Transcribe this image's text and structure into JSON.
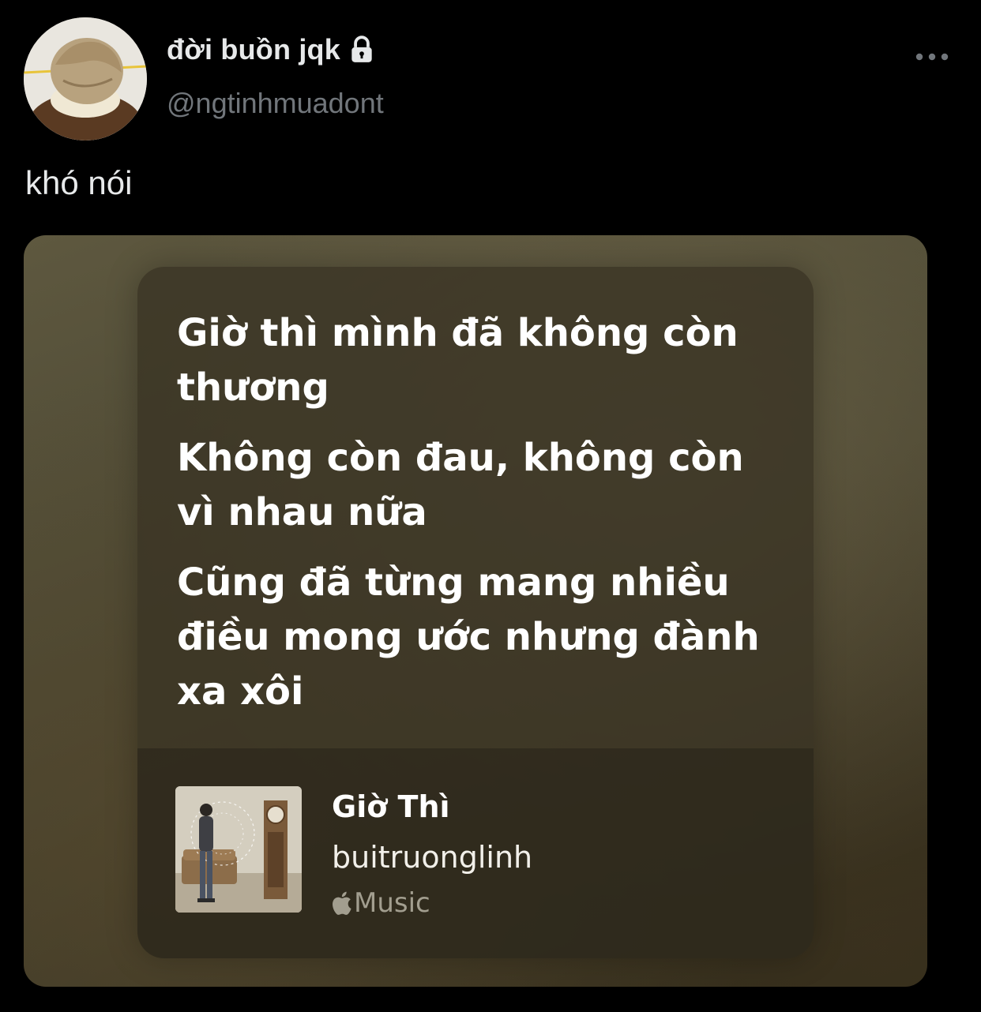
{
  "author": {
    "display_name": "đời buồn jqk",
    "handle": "@ngtinhmuadont",
    "avatar_icon": "avatar-photo",
    "protected_icon": "lock-icon"
  },
  "tweet": {
    "text": "khó nói",
    "more_icon": "more-dots-icon"
  },
  "media": {
    "lyrics": [
      "Giờ thì mình đã không còn thương",
      "Không còn đau, không còn vì nhau nữa",
      "Cũng đã từng mang nhiều điều mong ước nhưng đành xa xôi"
    ],
    "song": {
      "title": "Giờ Thì",
      "artist": "buitruonglinh",
      "service_label": "Music",
      "service_icon": "apple-logo-icon"
    }
  },
  "colors": {
    "background": "#000000",
    "primary_text": "#e7e9ea",
    "secondary_text": "#71767b",
    "card_tint": "#4e4a35"
  }
}
